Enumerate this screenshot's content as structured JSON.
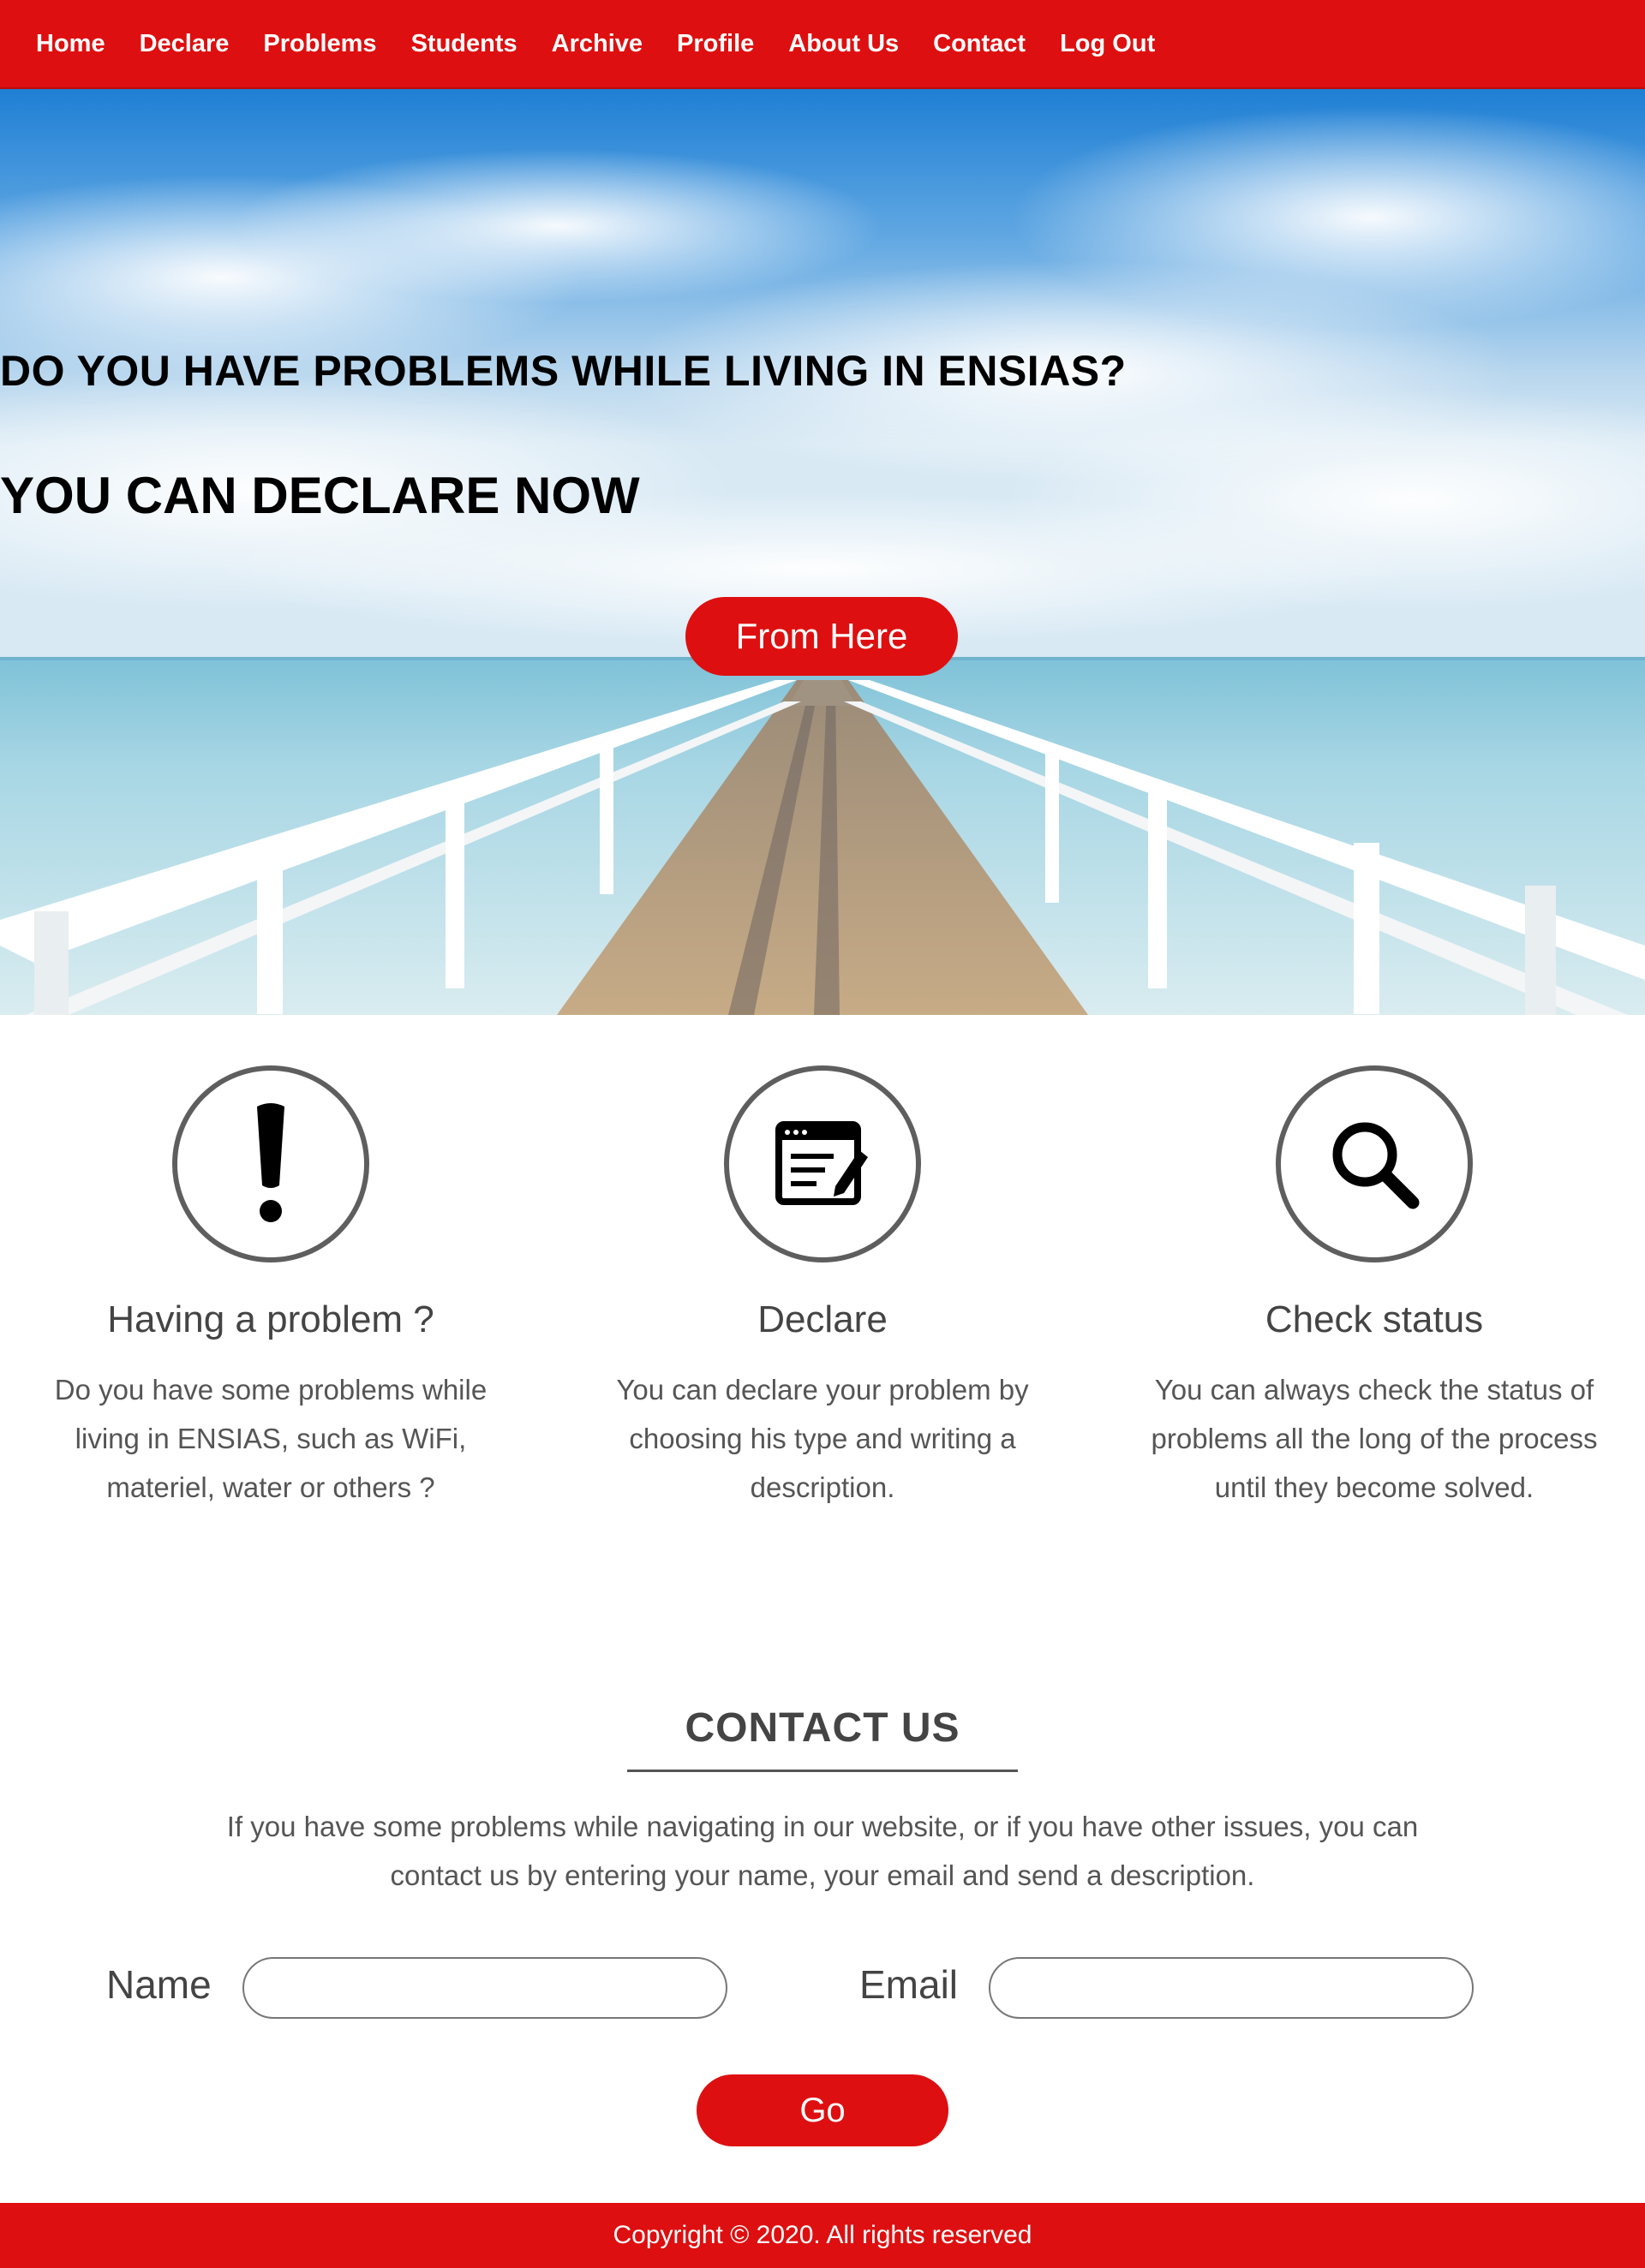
{
  "nav": {
    "items": [
      {
        "label": "Home"
      },
      {
        "label": "Declare"
      },
      {
        "label": "Problems"
      },
      {
        "label": "Students"
      },
      {
        "label": "Archive"
      },
      {
        "label": "Profile"
      },
      {
        "label": "About Us"
      },
      {
        "label": "Contact"
      },
      {
        "label": "Log Out"
      }
    ]
  },
  "hero": {
    "line1": "DO YOU HAVE PROBLEMS WHILE LIVING IN ENSIAS?",
    "line2": "YOU CAN DECLARE NOW",
    "button_label": "From Here"
  },
  "features": [
    {
      "icon": "exclamation-icon",
      "title": "Having a problem ?",
      "text": "Do you have some problems while living in ENSIAS, such as WiFi, materiel, water or others ?"
    },
    {
      "icon": "declare-form-icon",
      "title": "Declare",
      "text": "You can declare your problem by choosing his type and writing a description."
    },
    {
      "icon": "search-icon",
      "title": "Check status",
      "text": "You can always check the status of problems all the long of the process until they become solved."
    }
  ],
  "contact": {
    "title": "CONTACT US",
    "text": "If you have some problems while navigating in our website, or if you have other issues, you can contact us by entering your name, your email and send a description.",
    "name_label": "Name",
    "name_value": "",
    "email_label": "Email",
    "email_value": "",
    "submit_label": "Go"
  },
  "footer": {
    "copyright": "Copyright © 2020. All rights reserved"
  },
  "colors": {
    "brand_red": "#de0f10",
    "text_gray": "#4a4a4a"
  }
}
